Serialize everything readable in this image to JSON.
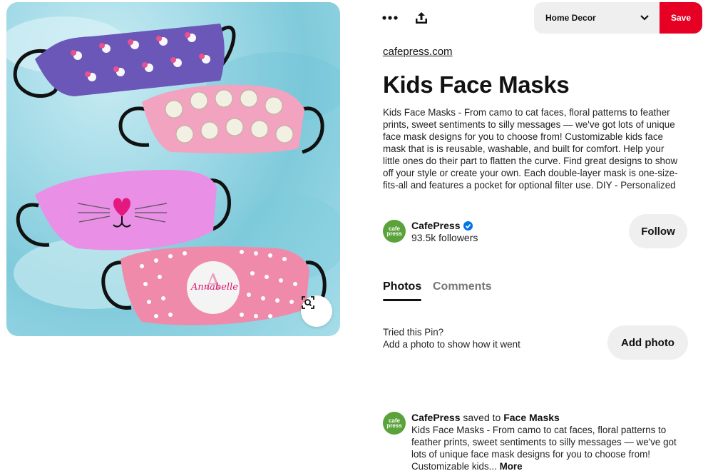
{
  "header": {
    "board_label": "Home Decor",
    "save_label": "Save",
    "icons": [
      "more-icon",
      "share-icon",
      "chevron-down-icon"
    ]
  },
  "colors": {
    "save": "#e60023",
    "pill": "#efefef",
    "verified": "#0074e8"
  },
  "pin": {
    "source": "cafepress.com",
    "title": "Kids Face Masks",
    "description": "Kids Face Masks - From camo to cat faces, floral patterns to feather prints, sweet sentiments to silly messages — we've got lots of unique face mask designs for you to choose from! Customizable kids face mask that is is reusable, washable, and built for comfort. Help your little ones do their part to flatten the curve. Find great designs to show off your style or create your own. Each double-layer mask is one-size-fits-all and features a pocket for optional filter use. DIY - Personalized",
    "image_text": "Annabelle",
    "monogram": "A"
  },
  "creator": {
    "avatar_top": "cafe",
    "avatar_bottom": "press",
    "name": "CafePress",
    "followers": "93.5k followers",
    "follow_label": "Follow"
  },
  "tabs": [
    {
      "label": "Photos"
    },
    {
      "label": "Comments"
    }
  ],
  "tried": {
    "question": "Tried this Pin?",
    "subtitle": "Add a photo to show how it went",
    "button": "Add photo"
  },
  "activity": {
    "user": "CafePress",
    "verb": "saved to",
    "board": "Face Masks",
    "description": "Kids Face Masks - From camo to cat faces, floral patterns to feather prints, sweet sentiments to silly messages — we've got lots of unique face mask designs for you to choose from! Customizable kids...",
    "more_label": "More"
  }
}
